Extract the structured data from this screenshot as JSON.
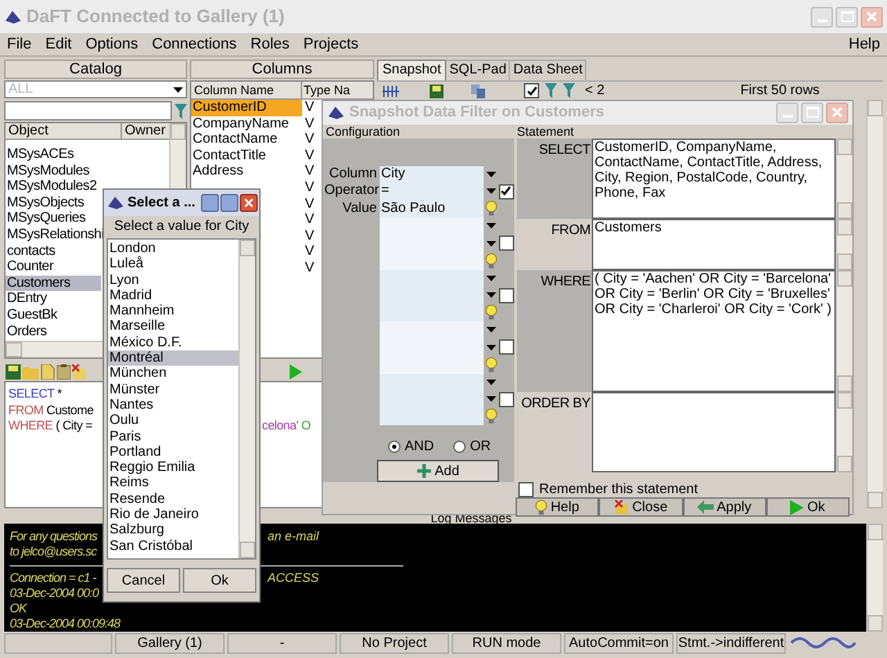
{
  "window": {
    "title": "DaFT Connected to Gallery (1)",
    "active": false
  },
  "menu": [
    {
      "label": "File"
    },
    {
      "label": "Edit"
    },
    {
      "label": "Options"
    },
    {
      "label": "Connections"
    },
    {
      "label": "Roles"
    },
    {
      "label": "Projects"
    }
  ],
  "help_menu": "Help",
  "catalog": {
    "title": "Catalog",
    "owner_filter": "ALL",
    "headers": [
      "Object",
      "Owner"
    ],
    "items": [
      {
        "name": "MSysACEs",
        "selected": false
      },
      {
        "name": "MSysModules",
        "selected": false
      },
      {
        "name": "MSysModules2",
        "selected": false
      },
      {
        "name": "MSysObjects",
        "selected": false
      },
      {
        "name": "MSysQueries",
        "selected": false
      },
      {
        "name": "MSysRelationshi",
        "selected": false
      },
      {
        "name": "contacts",
        "selected": false
      },
      {
        "name": "Counter",
        "selected": false
      },
      {
        "name": "Customers",
        "selected": true
      },
      {
        "name": "DEntry",
        "selected": false
      },
      {
        "name": "GuestBk",
        "selected": false
      },
      {
        "name": "Orders",
        "selected": false
      }
    ]
  },
  "columns_panel": {
    "title": "Columns",
    "headers": [
      "Column Name",
      "Type Na"
    ],
    "rows": [
      {
        "name": "CustomerID",
        "type": "V",
        "selected": true
      },
      {
        "name": "CompanyName",
        "type": "V",
        "selected": false
      },
      {
        "name": "ContactName",
        "type": "V",
        "selected": false
      },
      {
        "name": "ContactTitle",
        "type": "V",
        "selected": false
      },
      {
        "name": "Address",
        "type": "V",
        "selected": false
      },
      {
        "type": "V",
        "selected": false
      },
      {
        "type": "V",
        "selected": false
      },
      {
        "type": "V",
        "selected": false
      },
      {
        "type": "V",
        "selected": false
      },
      {
        "type": "V",
        "selected": false
      },
      {
        "type": "V",
        "selected": false
      }
    ]
  },
  "snapshot": {
    "tabs": [
      {
        "label": "Snapshot",
        "selected": true
      },
      {
        "label": "SQL-Pad",
        "selected": false
      },
      {
        "label": "Data Sheet",
        "selected": false
      }
    ],
    "option_checked": true,
    "page": "< 2",
    "rows_info": "First 50 rows"
  },
  "sql_editor": {
    "lines": [
      {
        "left": [
          {
            "text": "SELECT",
            "kind": "keyword"
          },
          {
            "text": "*",
            "kind": "plain"
          }
        ]
      },
      {
        "left": [
          {
            "text": "FROM",
            "kind": "clause"
          },
          {
            "text": "Custome",
            "kind": "plain"
          }
        ]
      },
      {
        "left": [
          {
            "text": "WHERE",
            "kind": "clause"
          },
          {
            "text": "( City =",
            "kind": "plain"
          }
        ],
        "right": [
          {
            "text": "celona'",
            "kind": "string"
          },
          {
            "text": "O",
            "kind": "operator"
          }
        ]
      }
    ]
  },
  "log": {
    "title": "Log Messages",
    "groups": [
      [
        {
          "left": "For any questions",
          "right": "an e-mail"
        },
        {
          "left": "to jelco@users.sc"
        }
      ],
      [
        {
          "left": "Connection = c1 -",
          "right": "ACCESS"
        },
        {
          "left": "03-Dec-2004 00:0"
        },
        {
          "left": "OK"
        },
        {
          "left": "03-Dec-2004 00:09:48"
        }
      ]
    ]
  },
  "status_bar": [
    "Gallery (1)",
    "-",
    "No Project",
    "RUN mode",
    "AutoCommit=on",
    "Stmt.->indifferent"
  ],
  "filter_dialog": {
    "title": "Snapshot Data Filter on Customers",
    "active": false,
    "configuration_label": "Configuration",
    "statement_label": "Statement",
    "fields": [
      {
        "label": "Column",
        "value": "City"
      },
      {
        "label": "Operator",
        "value": "="
      },
      {
        "label": "Value",
        "value": "São Paulo"
      }
    ],
    "groups": [
      {
        "checked": true
      },
      {
        "checked": false
      },
      {
        "checked": false
      },
      {
        "checked": false
      },
      {
        "checked": false
      }
    ],
    "logic": [
      {
        "label": "AND",
        "selected": true
      },
      {
        "label": "OR",
        "selected": false
      }
    ],
    "add_button": "Add",
    "clauses": [
      {
        "label": "SELECT",
        "text": "CustomerID, CompanyName, ContactName, ContactTitle, Address, City, Region, PostalCode, Country, Phone, Fax"
      },
      {
        "label": "FROM",
        "text": "Customers"
      },
      {
        "label": "WHERE",
        "text": "( City =  'Aachen' OR City =  'Barcelona' OR City =  'Berlin' OR City =  'Bruxelles' OR City = 'Charleroi' OR City =  'Cork' )"
      },
      {
        "label": "ORDER BY"
      }
    ],
    "remember": {
      "label": "Remember this statement",
      "checked": false
    },
    "buttons": [
      {
        "label": "Help",
        "kind": "help"
      },
      {
        "label": "Close",
        "kind": "close"
      },
      {
        "label": "Apply",
        "kind": "apply"
      },
      {
        "label": "Ok",
        "kind": "ok"
      }
    ]
  },
  "select_dialog": {
    "title": "Select a ...",
    "active": true,
    "prompt": "Select a value for City",
    "items": [
      {
        "name": "London",
        "selected": false
      },
      {
        "name": "Luleå",
        "selected": false
      },
      {
        "name": "Lyon",
        "selected": false
      },
      {
        "name": "Madrid",
        "selected": false
      },
      {
        "name": "Mannheim",
        "selected": false
      },
      {
        "name": "Marseille",
        "selected": false
      },
      {
        "name": "México D.F.",
        "selected": false
      },
      {
        "name": "Montréal",
        "selected": true
      },
      {
        "name": "München",
        "selected": false
      },
      {
        "name": "Münster",
        "selected": false
      },
      {
        "name": "Nantes",
        "selected": false
      },
      {
        "name": "Oulu",
        "selected": false
      },
      {
        "name": "Paris",
        "selected": false
      },
      {
        "name": "Portland",
        "selected": false
      },
      {
        "name": "Reggio Emilia",
        "selected": false
      },
      {
        "name": "Reims",
        "selected": false
      },
      {
        "name": "Resende",
        "selected": false
      },
      {
        "name": "Rio de Janeiro",
        "selected": false
      },
      {
        "name": "Salzburg",
        "selected": false
      },
      {
        "name": "San Cristóbal",
        "selected": false
      }
    ],
    "buttons": [
      "Cancel",
      "Ok"
    ]
  }
}
